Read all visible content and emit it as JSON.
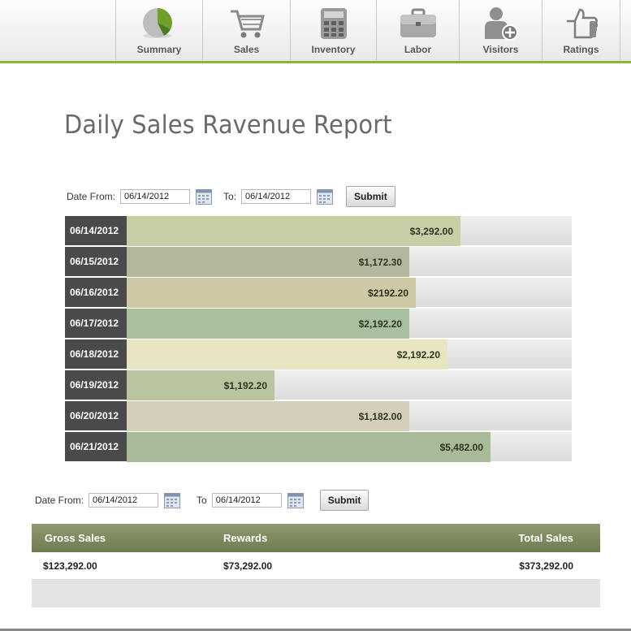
{
  "nav": {
    "items": [
      {
        "label": "Summary",
        "icon": "pie-chart-icon"
      },
      {
        "label": "Sales",
        "icon": "shopping-cart-icon"
      },
      {
        "label": "Inventory",
        "icon": "calculator-icon"
      },
      {
        "label": "Labor",
        "icon": "briefcase-icon"
      },
      {
        "label": "Visitors",
        "icon": "add-user-icon"
      },
      {
        "label": "Ratings",
        "icon": "thumbs-up-icon"
      }
    ],
    "accent_color": "#8db33a"
  },
  "page_title": "Daily Sales Ravenue Report",
  "top_filter": {
    "from_label": "Date From:",
    "from_value": "06/14/2012",
    "to_label": "To:",
    "to_value": "06/14/2012",
    "submit_label": "Submit"
  },
  "daily_sales": [
    {
      "date": "06/14/2012",
      "label": "$3,292.00",
      "fraction": 0.75,
      "color": "#c9ceA6"
    },
    {
      "date": "06/15/2012",
      "label": "$1,172.30",
      "fraction": 0.635,
      "color": "#b2b89e"
    },
    {
      "date": "06/16/2012",
      "label": "$2192.20",
      "fraction": 0.65,
      "color": "#cec8a4"
    },
    {
      "date": "06/17/2012",
      "label": "$2,192.20",
      "fraction": 0.635,
      "color": "#a9c0a0"
    },
    {
      "date": "06/18/2012",
      "label": "$2,192.20",
      "fraction": 0.72,
      "color": "#e8e5c2"
    },
    {
      "date": "06/19/2012",
      "label": "$1,192.20",
      "fraction": 0.333,
      "color": "#b9c4a0"
    },
    {
      "date": "06/20/2012",
      "label": "$1,182.00",
      "fraction": 0.635,
      "color": "#d3cfba"
    },
    {
      "date": "06/21/2012",
      "label": "$5,482.00",
      "fraction": 0.817,
      "color": "#a9ba98"
    }
  ],
  "bottom_filter": {
    "from_label": "Date From:",
    "from_value": "06/14/2012",
    "to_label": "To",
    "to_value": "06/14/2012",
    "submit_label": "Submit"
  },
  "summary": {
    "headers": {
      "gross": "Gross Sales",
      "rewards": "Rewards",
      "total": "Total Sales"
    },
    "values": {
      "gross": "$123,292.00",
      "rewards": "$73,292.00",
      "total": "$373,292.00"
    }
  }
}
